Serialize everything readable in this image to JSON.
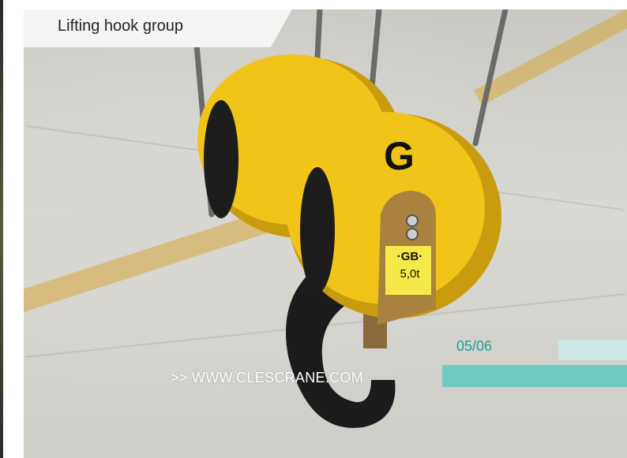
{
  "caption": {
    "title": "Lifting hook group"
  },
  "pager": {
    "current": "05/06"
  },
  "footer": {
    "url": ">> WWW.CLESCRANE.COM"
  },
  "plate": {
    "logo_letter": "G",
    "line1": "·GB·",
    "line2": "5,0t"
  },
  "colors": {
    "sheave_yellow": "#f0c419",
    "accent_teal": "#1fa39a",
    "bar_light": "#cde9e5",
    "bar_teal": "#6fcac0"
  }
}
